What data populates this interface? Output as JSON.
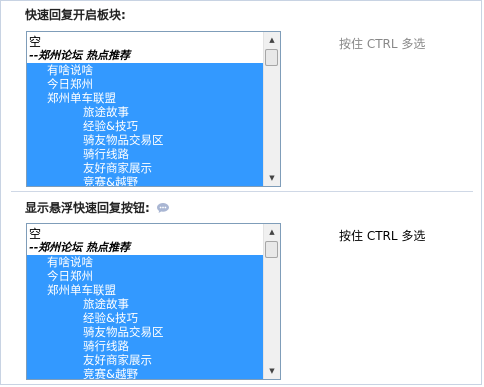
{
  "sections": [
    {
      "title": "快速回复开启板块:",
      "hint": "按住 CTRL 多选",
      "options": [
        {
          "label": "空",
          "kind": "first",
          "selected": false
        },
        {
          "label": "--郑州论坛 热点推荐",
          "kind": "group",
          "selected": false
        },
        {
          "label": "有啥说啥",
          "kind": "l1",
          "selected": true
        },
        {
          "label": "今日郑州",
          "kind": "l1",
          "selected": true
        },
        {
          "label": "郑州单车联盟",
          "kind": "l1",
          "selected": true
        },
        {
          "label": "旅途故事",
          "kind": "l2",
          "selected": true
        },
        {
          "label": "经验&技巧",
          "kind": "l2",
          "selected": true
        },
        {
          "label": "骑友物品交易区",
          "kind": "l2",
          "selected": true
        },
        {
          "label": "骑行线路",
          "kind": "l2",
          "selected": true
        },
        {
          "label": "友好商家展示",
          "kind": "l2",
          "selected": true
        },
        {
          "label": "竞赛&越野",
          "kind": "l2",
          "selected": true
        }
      ]
    },
    {
      "title": "显示悬浮快速回复按钮:",
      "hint": "按住 CTRL 多选",
      "options": [
        {
          "label": "空",
          "kind": "first",
          "selected": false
        },
        {
          "label": "--郑州论坛 热点推荐",
          "kind": "group",
          "selected": false
        },
        {
          "label": "有啥说啥",
          "kind": "l1",
          "selected": true
        },
        {
          "label": "今日郑州",
          "kind": "l1",
          "selected": true
        },
        {
          "label": "郑州单车联盟",
          "kind": "l1",
          "selected": true
        },
        {
          "label": "旅途故事",
          "kind": "l2",
          "selected": true
        },
        {
          "label": "经验&技巧",
          "kind": "l2",
          "selected": true
        },
        {
          "label": "骑友物品交易区",
          "kind": "l2",
          "selected": true
        },
        {
          "label": "骑行线路",
          "kind": "l2",
          "selected": true
        },
        {
          "label": "友好商家展示",
          "kind": "l2",
          "selected": true
        },
        {
          "label": "竞赛&越野",
          "kind": "l2",
          "selected": true
        }
      ]
    }
  ],
  "icons": {
    "help": "speech-bubble-help-icon",
    "scroll_up": "arrow-up-icon",
    "scroll_down": "arrow-down-icon"
  },
  "colors": {
    "selection": "#3399ff",
    "hint_gray": "#888888",
    "frame_border": "#c8d3e3",
    "help_icon": "#a9b6d3"
  }
}
